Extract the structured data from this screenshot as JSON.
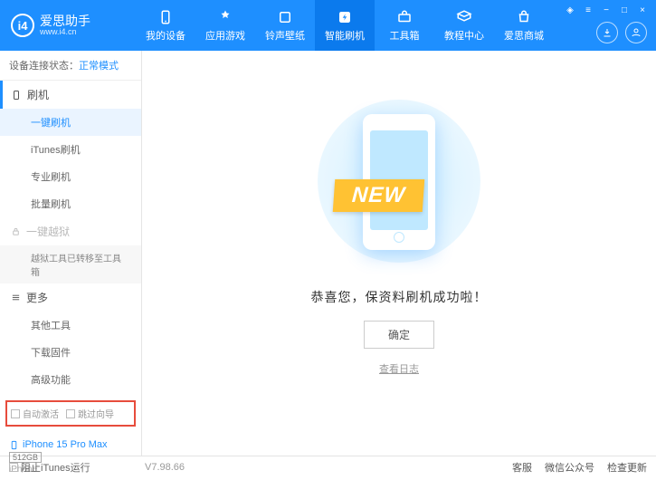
{
  "header": {
    "appName": "爱思助手",
    "url": "www.i4.cn",
    "nav": [
      "我的设备",
      "应用游戏",
      "铃声壁纸",
      "智能刷机",
      "工具箱",
      "教程中心",
      "爱思商城"
    ]
  },
  "sidebar": {
    "statusLabel": "设备连接状态：",
    "statusValue": "正常模式",
    "flashHead": "刷机",
    "items": {
      "oneKey": "一键刷机",
      "itunes": "iTunes刷机",
      "pro": "专业刷机",
      "batch": "批量刷机"
    },
    "jailbreakHead": "一键越狱",
    "jailbreakNote": "越狱工具已转移至工具箱",
    "moreHead": "更多",
    "moreItems": {
      "otherTools": "其他工具",
      "download": "下载固件",
      "advanced": "高级功能"
    },
    "checkboxes": {
      "autoActivate": "自动激活",
      "skipGuide": "跳过向导"
    },
    "device": {
      "name": "iPhone 15 Pro Max",
      "storage": "512GB",
      "type": "iPhone"
    }
  },
  "main": {
    "ribbon": "NEW",
    "message": "恭喜您，保资料刷机成功啦！",
    "okBtn": "确定",
    "logLink": "查看日志"
  },
  "footer": {
    "blockItunes": "阻止iTunes运行",
    "version": "V7.98.66",
    "links": [
      "客服",
      "微信公众号",
      "检查更新"
    ]
  }
}
